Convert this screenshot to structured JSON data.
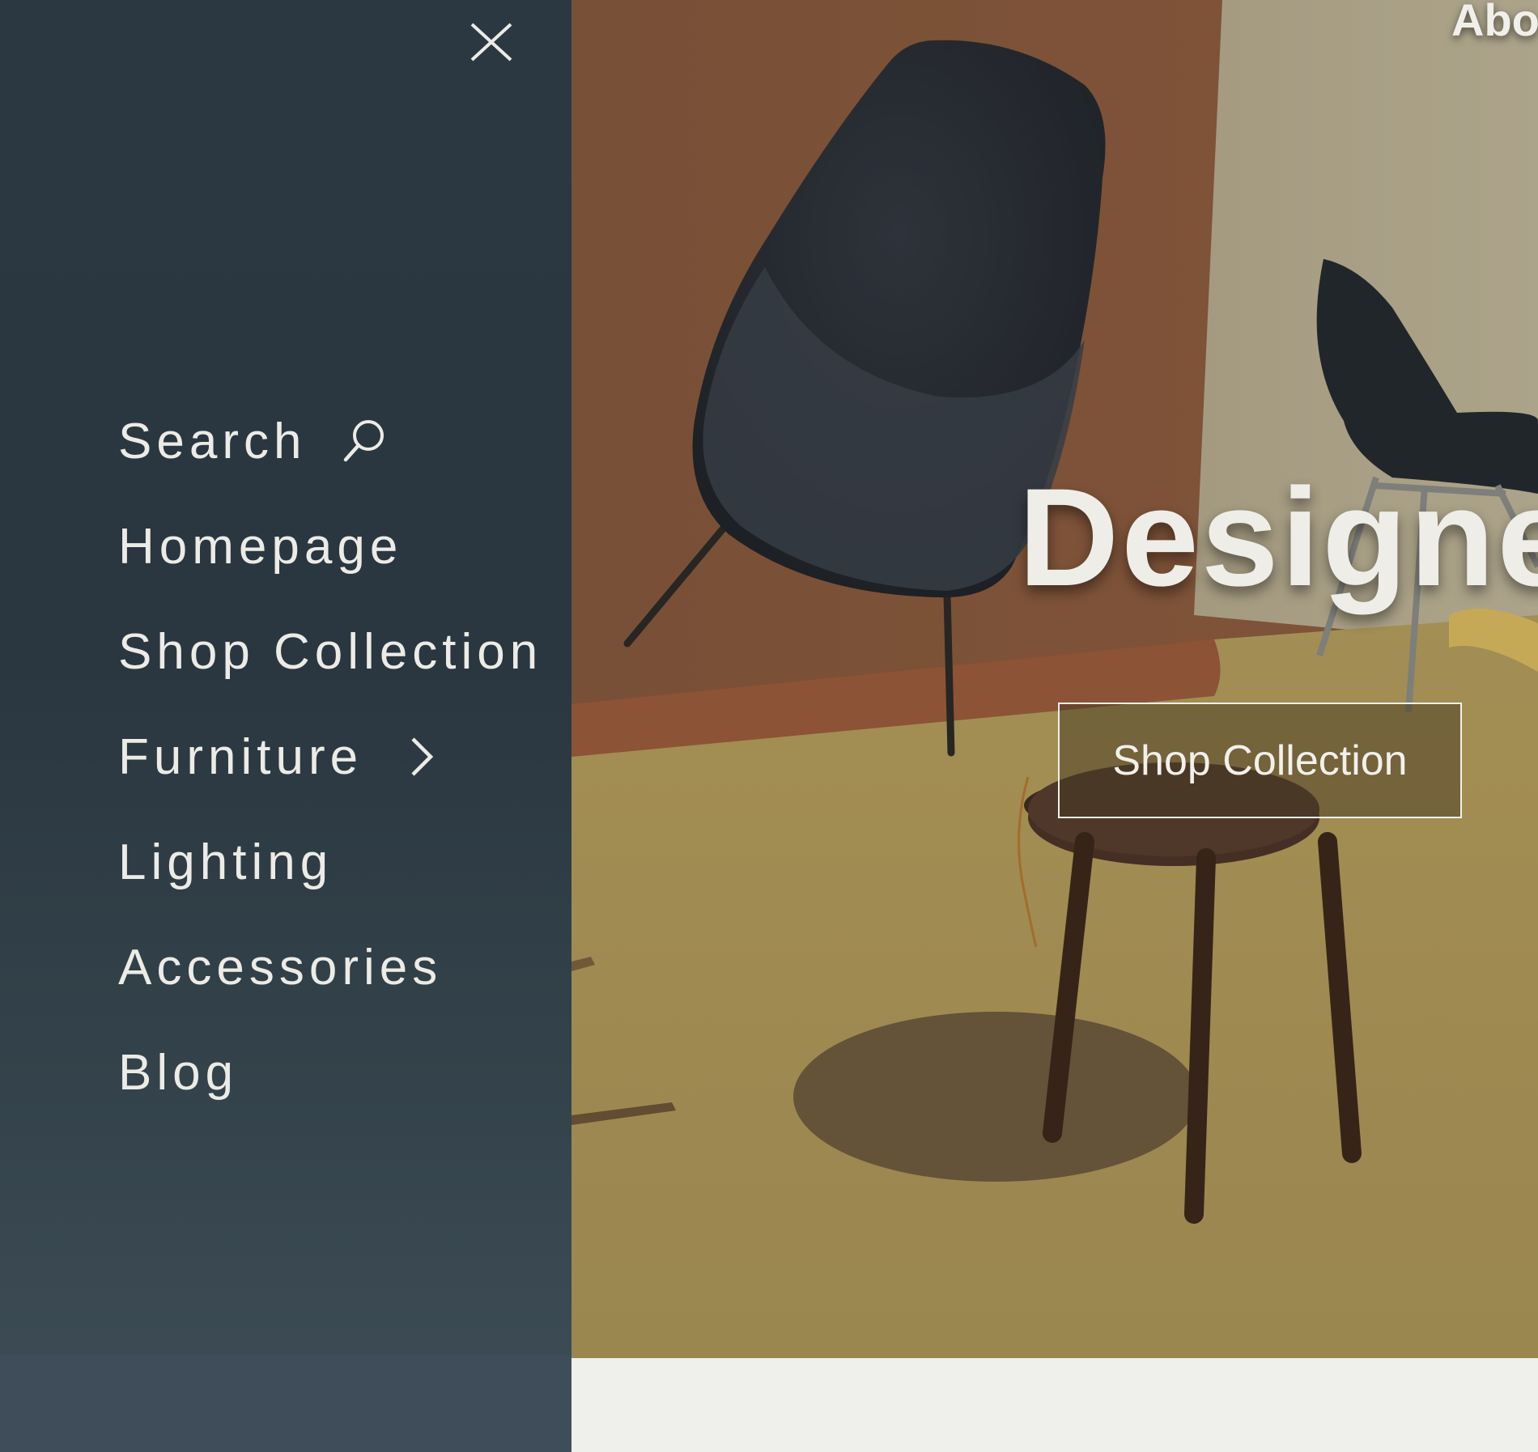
{
  "header": {
    "about_label": "Abo"
  },
  "hero": {
    "title": "Designed",
    "cta_label": "Shop Collection"
  },
  "drawer": {
    "close_icon": "close-icon",
    "menu": [
      {
        "label": "Search",
        "icon": "search-icon"
      },
      {
        "label": "Homepage"
      },
      {
        "label": "Shop Collection"
      },
      {
        "label": "Furniture",
        "icon": "chevron-right-icon"
      },
      {
        "label": "Lighting"
      },
      {
        "label": "Accessories"
      },
      {
        "label": "Blog"
      }
    ]
  },
  "colors": {
    "drawer_bg": "#2b3740",
    "menu_text": "#ecebe6",
    "hero_text": "#efede8",
    "footer_bg": "#efefeb"
  }
}
